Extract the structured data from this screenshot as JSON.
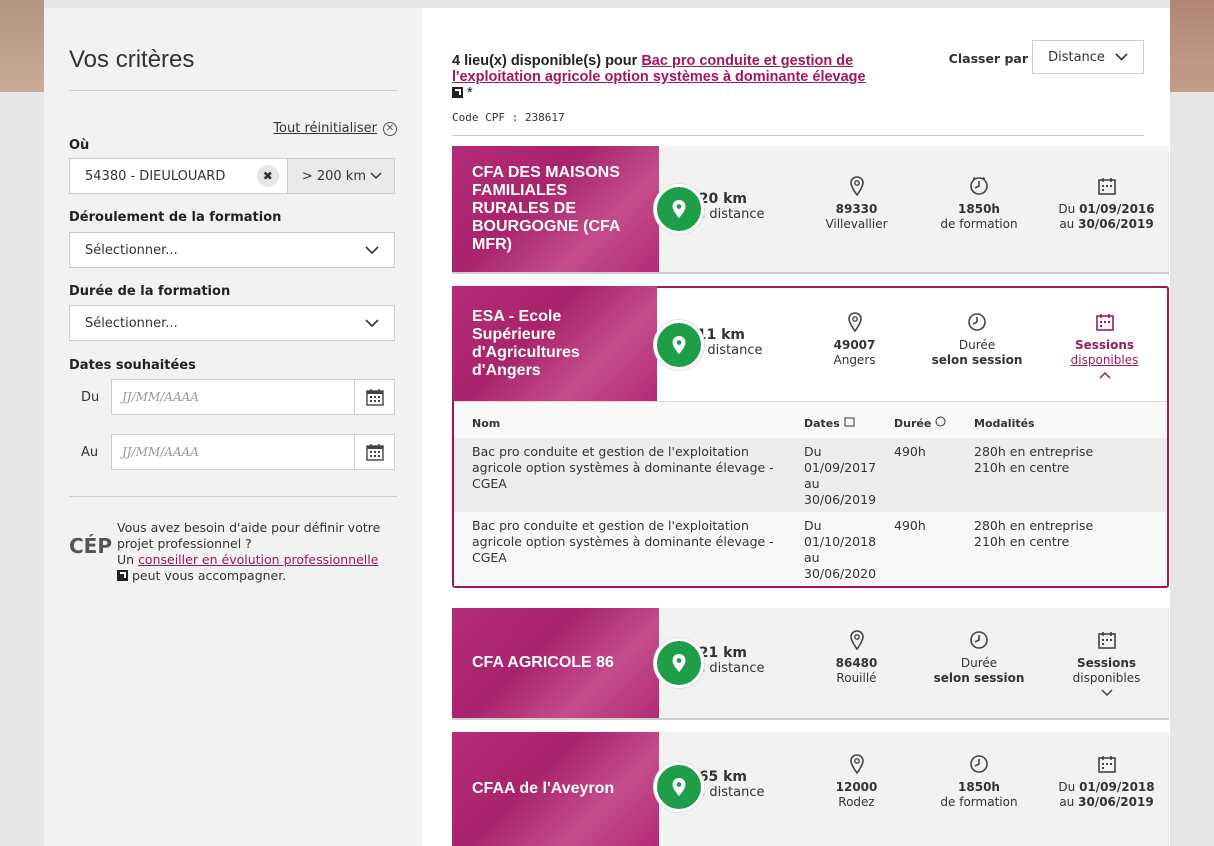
{
  "sidebar": {
    "title": "Vos critères",
    "reset_label": "Tout réinitialiser",
    "where_label": "Où",
    "where_value": "54380 - DIEULOUARD",
    "distance_value": "> 200 km",
    "deroulement_label": "Déroulement de la formation",
    "deroulement_value": "Sélectionner...",
    "duree_label": "Durée de la formation",
    "duree_value": "Sélectionner...",
    "dates_label": "Dates souhaitées",
    "du_label": "Du",
    "au_label": "Au",
    "date_placeholder": "JJ/MM/AAAA",
    "help_line1": "Vous avez besoin d'aide pour définir votre projet professionnel ?",
    "help_un": "Un",
    "help_link": "conseiller en évolution professionnelle",
    "help_tail": "peut vous accompagner.",
    "cep_logo": "CÉP"
  },
  "header": {
    "count_text": "4 lieu(x) disponible(s) pour",
    "formation_title": "Bac pro conduite et gestion de l'exploitation agricole option systèmes à dominante élevage",
    "asterisk": "*",
    "cpf_code": "Code CPF : 238617",
    "sort_label": "Classer par",
    "sort_value": "Distance"
  },
  "cards": [
    {
      "name": "CFA DES MAISONS FAMILIALES RURALES DE BOURGOGNE (CFA MFR)",
      "distance": "220 km",
      "distance_sub": "de distance",
      "postcode": "89330",
      "city": "Villevallier",
      "duration": "1850h",
      "duration_sub": "de formation",
      "dates_du": "Du",
      "dates_start": "01/09/2016",
      "dates_au": "au",
      "dates_end": "30/06/2019"
    },
    {
      "name": "ESA - Ecole Supérieure d'Agricultures d'Angers",
      "distance": "511 km",
      "distance_sub": "de distance",
      "postcode": "49007",
      "city": "Angers",
      "duration_top": "Durée",
      "duration": "selon session",
      "sessions_bold": "Sessions",
      "sessions_sub": "disponibles"
    },
    {
      "name": "CFA AGRICOLE 86",
      "distance": "521 km",
      "distance_sub": "de distance",
      "postcode": "86480",
      "city": "Rouillé",
      "duration_top": "Durée",
      "duration": "selon session",
      "sessions_bold": "Sessions",
      "sessions_sub": "disponibles"
    },
    {
      "name": "CFAA de l'Aveyron",
      "distance": "565 km",
      "distance_sub": "de distance",
      "postcode": "12000",
      "city": "Rodez",
      "duration": "1850h",
      "duration_sub": "de formation",
      "dates_du": "Du",
      "dates_start": "01/09/2018",
      "dates_au": "au",
      "dates_end": "30/06/2019"
    }
  ],
  "sessions_table": {
    "headers": {
      "nom": "Nom",
      "dates": "Dates",
      "duree": "Durée",
      "modalites": "Modalités"
    },
    "rows": [
      {
        "nom": "Bac pro conduite et gestion de l'exploitation agricole option systèmes à dominante élevage - CGEA",
        "du": "Du",
        "start": "01/09/2017",
        "au": "au",
        "end": "30/06/2019",
        "duree": "490h",
        "mod1": "280h en entreprise",
        "mod2": "210h en centre"
      },
      {
        "nom": "Bac pro conduite et gestion de l'exploitation agricole option systèmes à dominante élevage - CGEA",
        "du": "Du",
        "start": "01/10/2018",
        "au": "au",
        "end": "30/06/2020",
        "duree": "490h",
        "mod1": "280h en entreprise",
        "mod2": "210h en centre"
      }
    ]
  },
  "colors": {
    "accent": "#a0175f",
    "pin": "#1f9e4a"
  }
}
